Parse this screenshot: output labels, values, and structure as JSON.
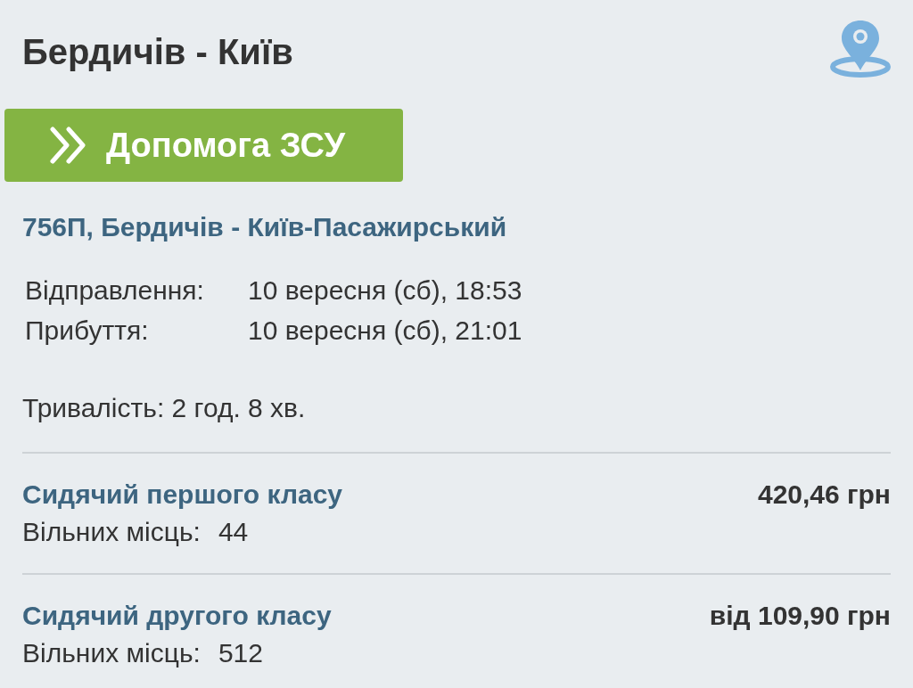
{
  "header": {
    "title": "Бердичів - Київ"
  },
  "donate_button": {
    "label": "Допомога ЗСУ"
  },
  "train": {
    "name": "756П, Бердичів - Київ-Пасажирський",
    "schedule": [
      {
        "label": "Відправлення:",
        "value": "10 вересня (сб), 18:53"
      },
      {
        "label": "Прибуття:",
        "value": "10 вересня (сб), 21:01"
      }
    ],
    "duration": "Тривалість: 2 год. 8 хв."
  },
  "seat_classes": [
    {
      "name": "Сидячий першого класу",
      "price": "420,46 грн",
      "availability_label": "Вільних місць:",
      "availability": "44"
    },
    {
      "name": "Сидячий другого класу",
      "price": "від 109,90 грн",
      "availability_label": "Вільних місць:",
      "availability": "512"
    }
  ]
}
